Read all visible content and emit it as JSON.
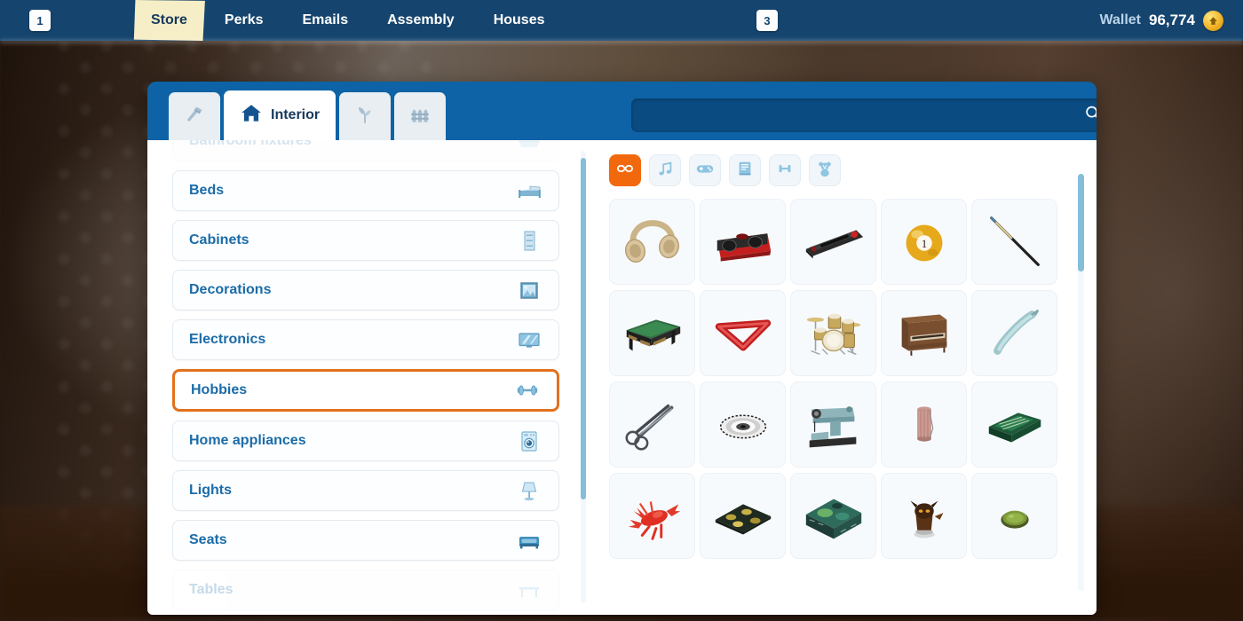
{
  "topbar": {
    "badge_left": "1",
    "badge_mid": "3",
    "nav_items": [
      {
        "label": "Store",
        "active": true
      },
      {
        "label": "Perks",
        "active": false
      },
      {
        "label": "Emails",
        "active": false
      },
      {
        "label": "Assembly",
        "active": false
      },
      {
        "label": "Houses",
        "active": false
      }
    ],
    "wallet_label": "Wallet",
    "wallet_amount": "96,774",
    "coin_icon": "coin-icon",
    "accent_blue": "#15456e"
  },
  "store": {
    "tabs": [
      {
        "name": "build-tab",
        "icon": "hammer-icon",
        "label": "",
        "active": false
      },
      {
        "name": "interior-tab",
        "icon": "house-icon",
        "label": "Interior",
        "active": true
      },
      {
        "name": "garden-tab",
        "icon": "plant-icon",
        "label": "",
        "active": false
      },
      {
        "name": "fence-tab",
        "icon": "fence-icon",
        "label": "",
        "active": false
      }
    ],
    "search": {
      "value": "",
      "placeholder": "",
      "icon": "search-icon"
    },
    "categories": [
      {
        "label": "Bathroom fixtures",
        "icon": "bathtub-icon",
        "state": "clipped"
      },
      {
        "label": "Beds",
        "icon": "bed-icon",
        "state": "normal"
      },
      {
        "label": "Cabinets",
        "icon": "cabinet-icon",
        "state": "normal"
      },
      {
        "label": "Decorations",
        "icon": "picture-frame-icon",
        "state": "normal"
      },
      {
        "label": "Electronics",
        "icon": "tv-icon",
        "state": "normal"
      },
      {
        "label": "Hobbies",
        "icon": "dumbbell-icon",
        "state": "selected"
      },
      {
        "label": "Home appliances",
        "icon": "washing-machine-icon",
        "state": "normal"
      },
      {
        "label": "Lights",
        "icon": "lamp-icon",
        "state": "normal"
      },
      {
        "label": "Seats",
        "icon": "armchair-icon",
        "state": "normal"
      },
      {
        "label": "Tables",
        "icon": "table-icon",
        "state": "clipped-bottom"
      }
    ],
    "selected_category": "Hobbies",
    "selected_border_color": "#e2711d",
    "filters": [
      {
        "name": "filter-all",
        "icon": "infinity-icon",
        "active": true
      },
      {
        "name": "filter-music",
        "icon": "music-note-icon",
        "active": false
      },
      {
        "name": "filter-games",
        "icon": "gamepad-icon",
        "active": false
      },
      {
        "name": "filter-books",
        "icon": "book-icon",
        "active": false
      },
      {
        "name": "filter-fitness",
        "icon": "dumbbell-icon",
        "active": false
      },
      {
        "name": "filter-toys",
        "icon": "teddy-bear-icon",
        "active": false
      }
    ],
    "items": [
      {
        "name": "headphones",
        "icon": "headphones-item"
      },
      {
        "name": "boombox",
        "icon": "boombox-item"
      },
      {
        "name": "handheld-console",
        "icon": "handheld-console-item"
      },
      {
        "name": "billiard-ball",
        "icon": "billiard-ball-item"
      },
      {
        "name": "pool-cue",
        "icon": "pool-cue-item"
      },
      {
        "name": "pool-table",
        "icon": "pool-table-item"
      },
      {
        "name": "ball-rack",
        "icon": "ball-rack-item"
      },
      {
        "name": "drum-kit",
        "icon": "drum-kit-item"
      },
      {
        "name": "upright-piano",
        "icon": "piano-item"
      },
      {
        "name": "crochet-hook",
        "icon": "crochet-hook-item"
      },
      {
        "name": "scissors",
        "icon": "scissors-item"
      },
      {
        "name": "embroidery-hoop",
        "icon": "embroidery-hoop-item"
      },
      {
        "name": "sewing-machine",
        "icon": "sewing-machine-item"
      },
      {
        "name": "thread-spool",
        "icon": "thread-spool-item"
      },
      {
        "name": "board-game-book",
        "icon": "board-game-book-item"
      },
      {
        "name": "lobster-figure",
        "icon": "lobster-item"
      },
      {
        "name": "game-mat",
        "icon": "game-mat-item"
      },
      {
        "name": "board-game-box",
        "icon": "board-game-box-item"
      },
      {
        "name": "miniature-figure",
        "icon": "miniature-figure-item"
      },
      {
        "name": "green-token",
        "icon": "green-token-item"
      }
    ],
    "scrollbar_color": "#86bdd9"
  }
}
